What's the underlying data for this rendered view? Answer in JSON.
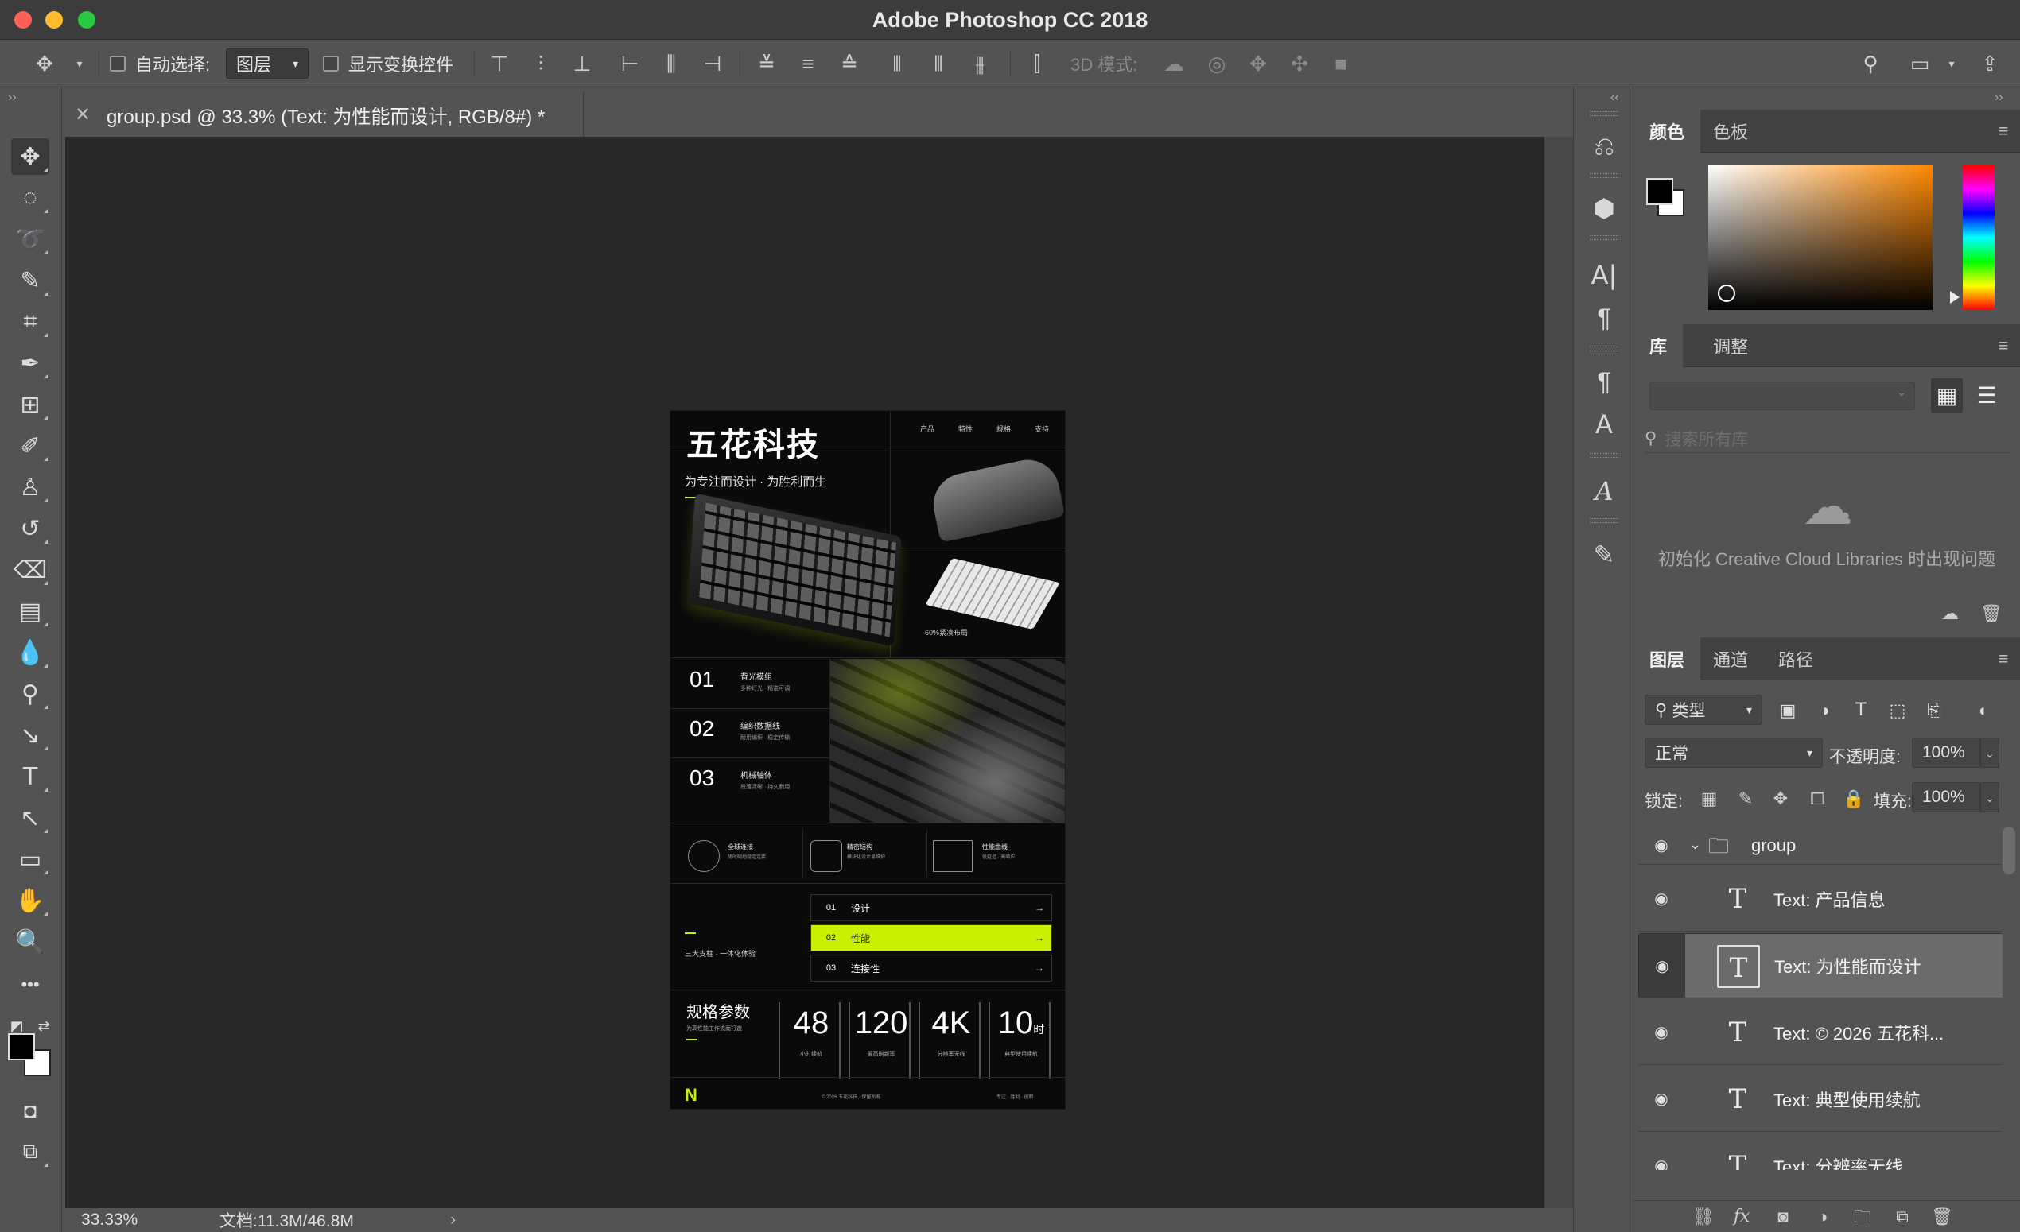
{
  "window": {
    "title": "Adobe Photoshop CC 2018"
  },
  "options": {
    "auto_select_label": "自动选择:",
    "auto_select_value": "图层",
    "show_transform_label": "显示变换控件",
    "mode_3d_label": "3D 模式:"
  },
  "document": {
    "tab_title": "group.psd @ 33.3% (Text: 为性能而设计, RGB/8#) *",
    "zoom": "33.33%",
    "doc_size": "文档:11.3M/46.8M"
  },
  "artwork": {
    "brand": "五花科技",
    "nav": [
      "产品",
      "特性",
      "规格",
      "支持"
    ],
    "slogan": "为专注而设计 · 为胜利而生",
    "caption": "60%紧凑布局",
    "features": [
      {
        "num": "01",
        "title": "背光模组",
        "desc": "多种灯光 · 精准可调"
      },
      {
        "num": "02",
        "title": "编织数据线",
        "desc": "耐用编织 · 稳定传输"
      },
      {
        "num": "03",
        "title": "机械轴体",
        "desc": "段落清晰 · 持久耐用"
      }
    ],
    "icons": [
      {
        "title": "全球连接",
        "desc": "随时随地稳定连接"
      },
      {
        "title": "精密结构",
        "desc": "模块化设计易维护"
      },
      {
        "title": "性能曲线",
        "desc": "低延迟 · 高响应"
      }
    ],
    "left_note": "三大支柱 · 一体化体验",
    "menu": [
      {
        "num": "01",
        "label": "设计",
        "arrow": "→"
      },
      {
        "num": "02",
        "label": "性能",
        "arrow": "→"
      },
      {
        "num": "03",
        "label": "连接性",
        "arrow": "→"
      }
    ],
    "spec_title": "规格参数",
    "spec_sub": "为高性能工作流而打造",
    "specs": [
      {
        "value": "48",
        "unit": "",
        "label": "小时续航"
      },
      {
        "value": "120",
        "unit": "",
        "label": "最高刷新率"
      },
      {
        "value": "4K",
        "unit": "",
        "label": "分辨率无线"
      },
      {
        "value": "10",
        "unit": "时",
        "label": "典型使用续航"
      }
    ],
    "foot_logo": "N",
    "foot_center": "© 2026 五花科技 · 保留所有",
    "foot_right": "专注 · 胜利 · 创新"
  },
  "panels": {
    "color_tabs": [
      "颜色",
      "色板"
    ],
    "library_tabs": [
      "库",
      "调整"
    ],
    "library_search_placeholder": "搜索所有库",
    "library_message": "初始化 Creative Cloud Libraries 时出现问题",
    "layers_tabs": [
      "图层",
      "通道",
      "路径"
    ],
    "layer_filter": "类型",
    "blend_mode": "正常",
    "opacity_label": "不透明度:",
    "opacity_value": "100%",
    "lock_label": "锁定:",
    "fill_label": "填充:",
    "fill_value": "100%",
    "layers": [
      {
        "name": "group",
        "kind": "group"
      },
      {
        "name": "Text: 产品信息",
        "kind": "text"
      },
      {
        "name": "Text: 为性能而设计",
        "kind": "text",
        "selected": true
      },
      {
        "name": "Text: © 2026 五花科...",
        "kind": "text"
      },
      {
        "name": "Text: 典型使用续航",
        "kind": "text"
      },
      {
        "name": "Text: 分辨率无线",
        "kind": "text"
      }
    ]
  },
  "colors": {
    "accent_lime": "#c8f000",
    "ui_bg": "#535353",
    "canvas_bg": "#282828"
  },
  "icons": {
    "move": "✥",
    "marquee": "◌",
    "lasso": "ʘ",
    "quick-select": "⊙",
    "crop": "⌗",
    "eyedropper": "✎",
    "frame": "⊞",
    "brush": "✐",
    "stamp": "⊥",
    "history-brush": "↺",
    "eraser": "⌫",
    "gradient": "▭",
    "blur": "💧",
    "dodge": "●",
    "pen": "↖",
    "type": "T",
    "path-select": "↖",
    "rectangle": "▭",
    "hand": "✋",
    "zoom": "🔍",
    "more": "•••"
  }
}
